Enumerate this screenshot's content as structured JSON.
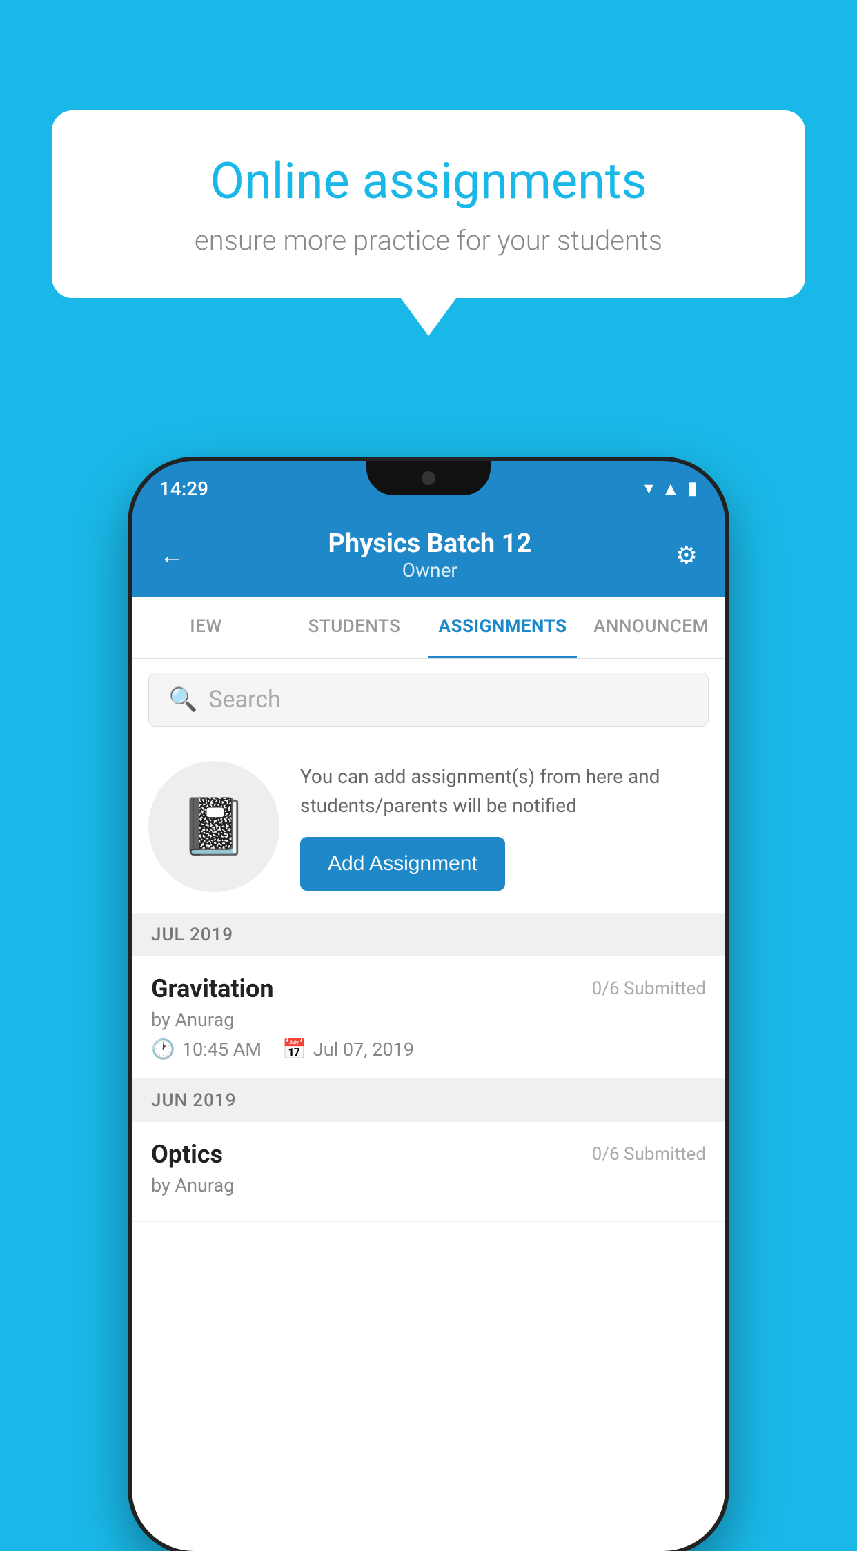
{
  "background_color": "#1ab8e8",
  "speech_bubble": {
    "title": "Online assignments",
    "subtitle": "ensure more practice for your students"
  },
  "status_bar": {
    "time": "14:29"
  },
  "app_header": {
    "title": "Physics Batch 12",
    "subtitle": "Owner",
    "back_label": "←",
    "settings_label": "⚙"
  },
  "tabs": [
    {
      "label": "IEW",
      "active": false
    },
    {
      "label": "STUDENTS",
      "active": false
    },
    {
      "label": "ASSIGNMENTS",
      "active": true
    },
    {
      "label": "ANNOUNCEM",
      "active": false
    }
  ],
  "search": {
    "placeholder": "Search"
  },
  "promo": {
    "description": "You can add assignment(s) from here and students/parents will be notified",
    "button_label": "Add Assignment"
  },
  "sections": [
    {
      "month_label": "JUL 2019",
      "assignments": [
        {
          "name": "Gravitation",
          "submitted": "0/6 Submitted",
          "by": "by Anurag",
          "time": "10:45 AM",
          "date": "Jul 07, 2019"
        }
      ]
    },
    {
      "month_label": "JUN 2019",
      "assignments": [
        {
          "name": "Optics",
          "submitted": "0/6 Submitted",
          "by": "by Anurag",
          "time": "",
          "date": ""
        }
      ]
    }
  ]
}
